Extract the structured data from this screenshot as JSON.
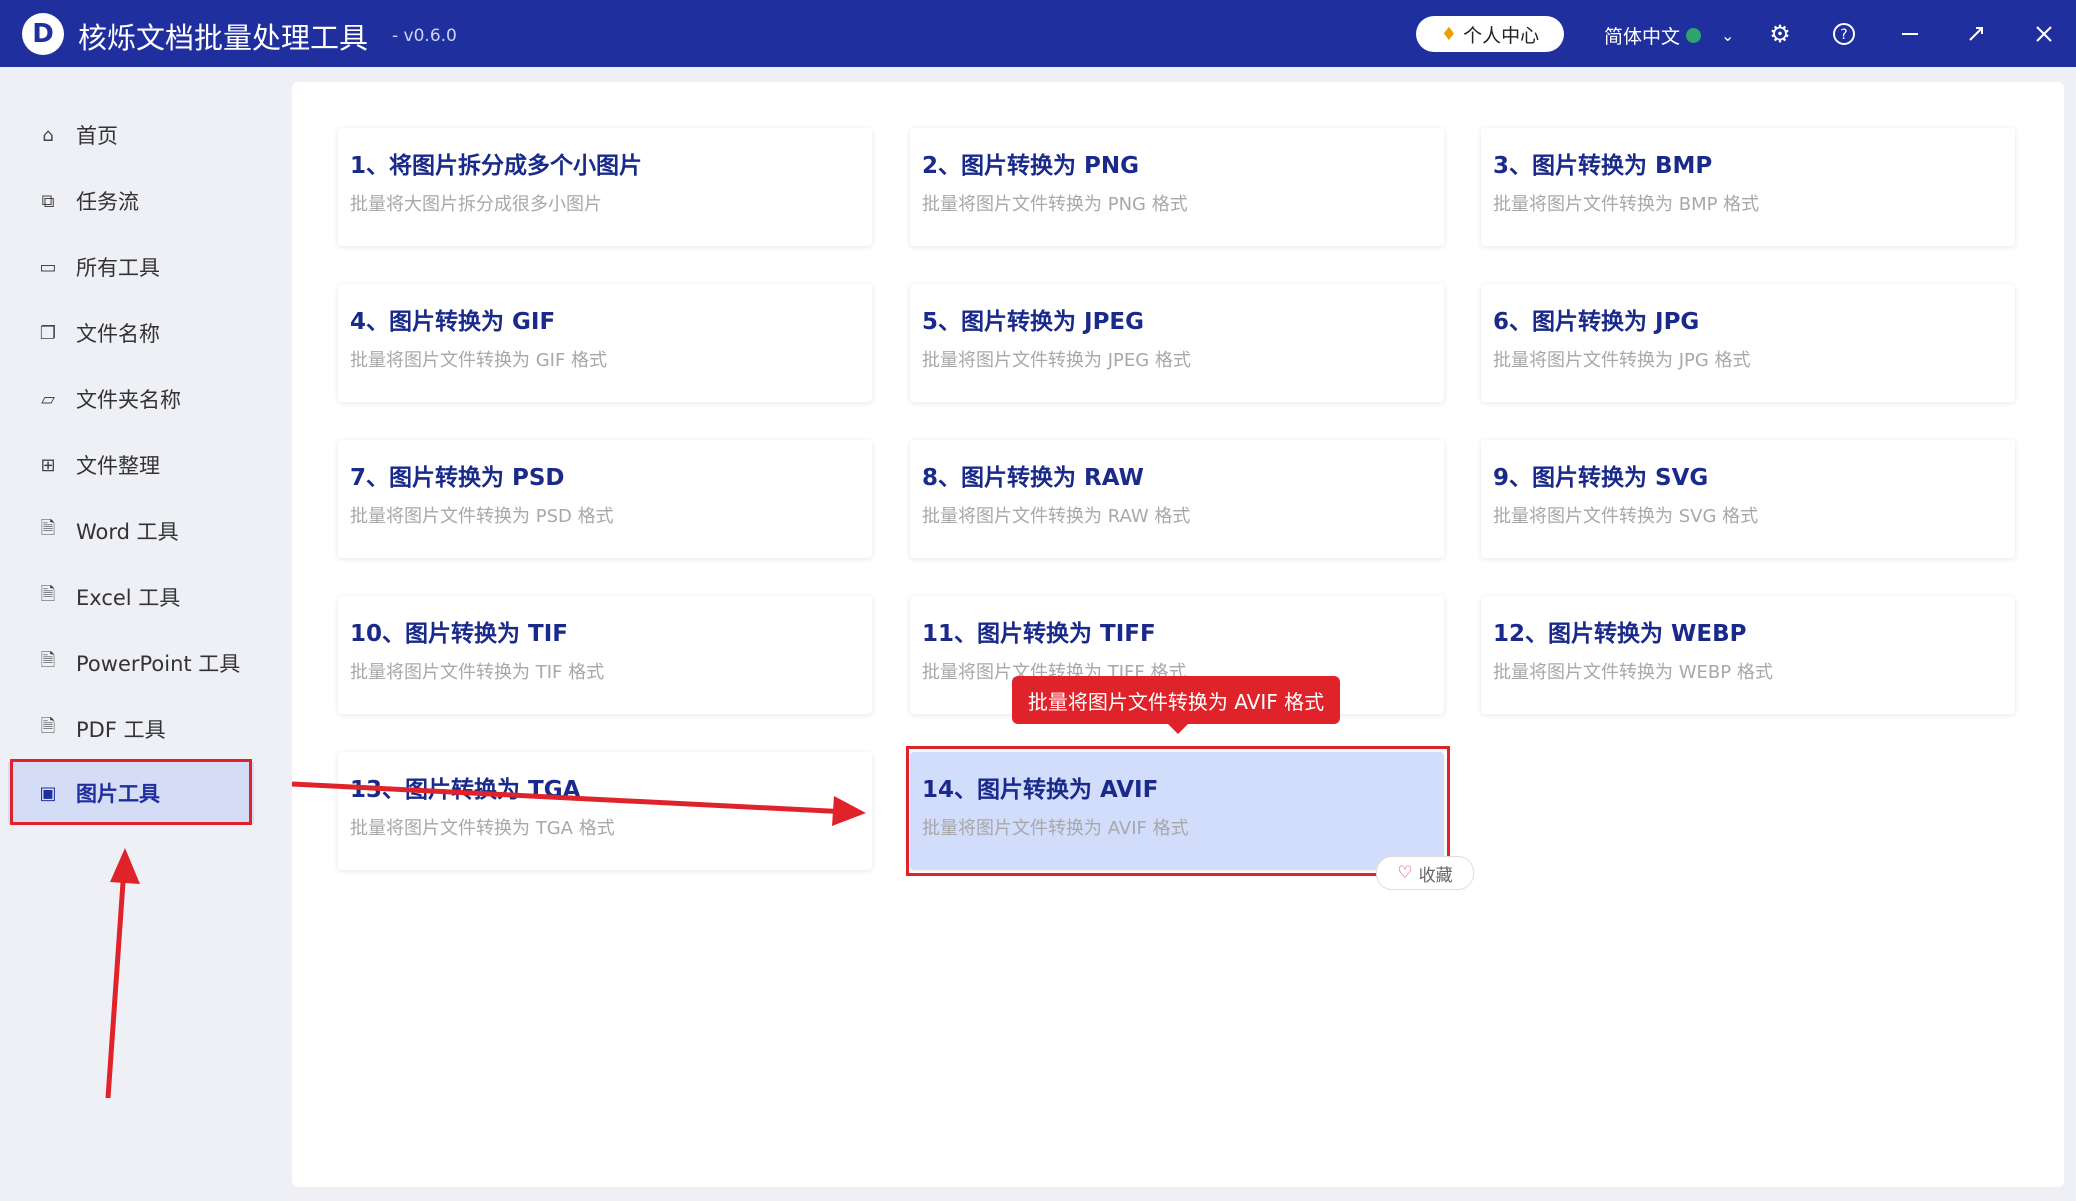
{
  "titlebar": {
    "logo_letter": "D",
    "app_name": "核烁文档批量处理工具",
    "version": "- v0.6.0",
    "user_center": "个人中心",
    "language": "简体中文"
  },
  "sidebar": {
    "items": [
      {
        "label": "首页",
        "icon": "home-icon"
      },
      {
        "label": "任务流",
        "icon": "workflow-icon"
      },
      {
        "label": "所有工具",
        "icon": "monitor-icon"
      },
      {
        "label": "文件名称",
        "icon": "file-name-icon"
      },
      {
        "label": "文件夹名称",
        "icon": "folder-icon"
      },
      {
        "label": "文件整理",
        "icon": "organize-icon"
      },
      {
        "label": "Word 工具",
        "icon": "word-icon"
      },
      {
        "label": "Excel 工具",
        "icon": "excel-icon"
      },
      {
        "label": "PowerPoint 工具",
        "icon": "powerpoint-icon"
      },
      {
        "label": "PDF 工具",
        "icon": "pdf-icon"
      },
      {
        "label": "图片工具",
        "icon": "image-icon"
      }
    ],
    "active_index": 10
  },
  "tools": [
    {
      "title": "1、将图片拆分成多个小图片",
      "desc": "批量将大图片拆分成很多小图片"
    },
    {
      "title": "2、图片转换为 PNG",
      "desc": "批量将图片文件转换为 PNG 格式"
    },
    {
      "title": "3、图片转换为 BMP",
      "desc": "批量将图片文件转换为 BMP 格式"
    },
    {
      "title": "4、图片转换为 GIF",
      "desc": "批量将图片文件转换为 GIF 格式"
    },
    {
      "title": "5、图片转换为 JPEG",
      "desc": "批量将图片文件转换为 JPEG 格式"
    },
    {
      "title": "6、图片转换为 JPG",
      "desc": "批量将图片文件转换为 JPG 格式"
    },
    {
      "title": "7、图片转换为 PSD",
      "desc": "批量将图片文件转换为 PSD 格式"
    },
    {
      "title": "8、图片转换为 RAW",
      "desc": "批量将图片文件转换为 RAW 格式"
    },
    {
      "title": "9、图片转换为 SVG",
      "desc": "批量将图片文件转换为 SVG 格式"
    },
    {
      "title": "10、图片转换为 TIF",
      "desc": "批量将图片文件转换为 TIF 格式"
    },
    {
      "title": "11、图片转换为 TIFF",
      "desc": "批量将图片文件转换为 TIFF 格式"
    },
    {
      "title": "12、图片转换为 WEBP",
      "desc": "批量将图片文件转换为 WEBP 格式"
    },
    {
      "title": "13、图片转换为 TGA",
      "desc": "批量将图片文件转换为 TGA 格式"
    },
    {
      "title": "14、图片转换为 AVIF",
      "desc": "批量将图片文件转换为 AVIF 格式"
    }
  ],
  "hovered_tool_index": 13,
  "tooltip": "批量将图片文件转换为 AVIF 格式",
  "favorite_label": "收藏",
  "colors": {
    "titlebar": "#1f2f9e",
    "card_title": "#1a2a8a",
    "highlight": "#e0232b",
    "active_card": "#d2dcfb"
  }
}
